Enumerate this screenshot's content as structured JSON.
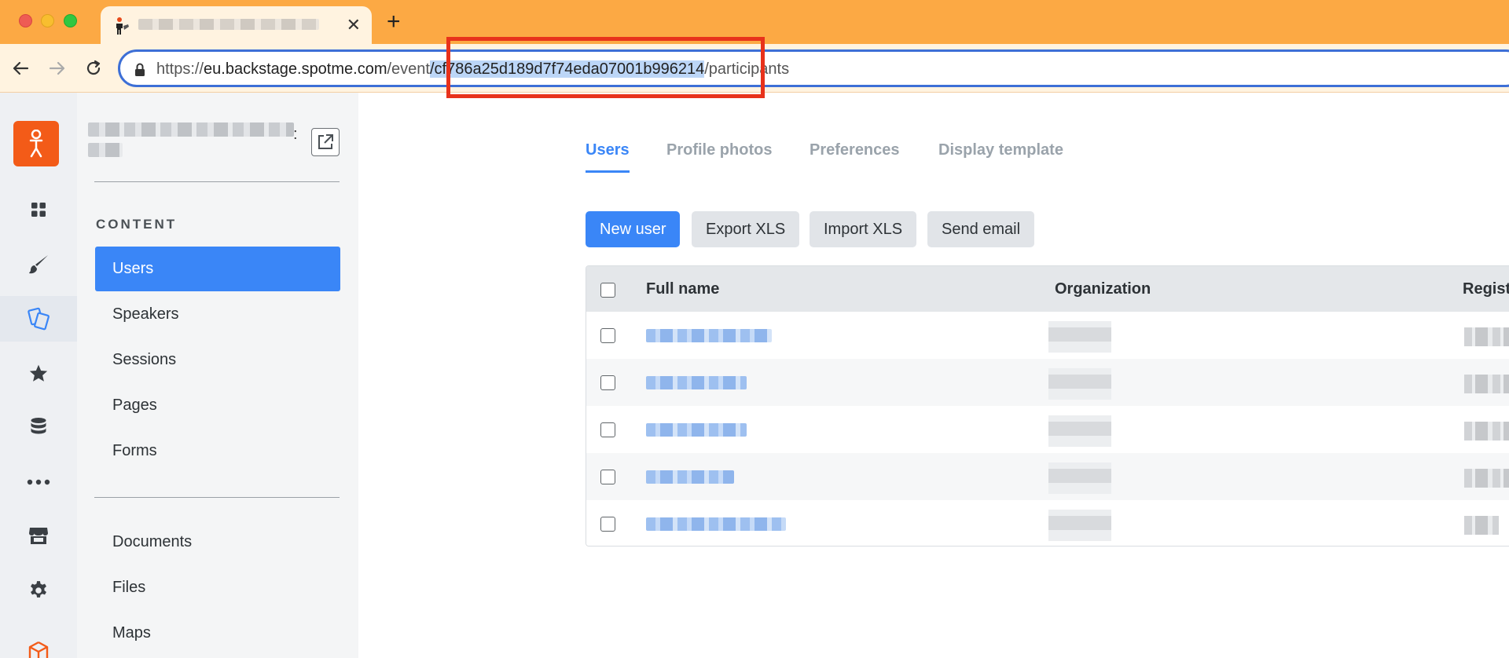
{
  "browser": {
    "tab": {
      "title": "",
      "favicon": "spotme-figure-icon",
      "close": "✕"
    },
    "new_tab": "+",
    "url": {
      "prefix": "https://",
      "host": "eu.backstage.spotme.com",
      "path_before": "/event",
      "selected": "/cf786a25d189d7f74eda07001b996214",
      "path_after": "/participants"
    },
    "highlight_color": "#e8321b"
  },
  "rail": {
    "logo": "spotme-logo-icon",
    "items": [
      {
        "icon": "dashboard-icon"
      },
      {
        "icon": "brush-icon"
      },
      {
        "icon": "content-cards-icon",
        "active": true
      },
      {
        "icon": "star-icon"
      },
      {
        "icon": "database-icon"
      },
      {
        "icon": "more-icon"
      },
      {
        "icon": "store-icon"
      },
      {
        "icon": "settings-icon"
      },
      {
        "icon": "cube-icon"
      }
    ]
  },
  "sidebar": {
    "event_colon": ":",
    "section_heading": "CONTENT",
    "items": [
      "Users",
      "Speakers",
      "Sessions",
      "Pages",
      "Forms"
    ],
    "items2": [
      "Documents",
      "Files",
      "Maps"
    ],
    "active": "Users"
  },
  "main": {
    "tabs": [
      "Users",
      "Profile photos",
      "Preferences",
      "Display template"
    ],
    "buttons": {
      "new_user": "New user",
      "export": "Export XLS",
      "import": "Import XLS",
      "email": "Send email"
    },
    "table": {
      "headers": {
        "full_name": "Full name",
        "organization": "Organization",
        "registration": "Regist"
      }
    }
  },
  "colors": {
    "accent": "#3a86f7",
    "brand": "#f35b18",
    "tabbar": "#fca944"
  }
}
